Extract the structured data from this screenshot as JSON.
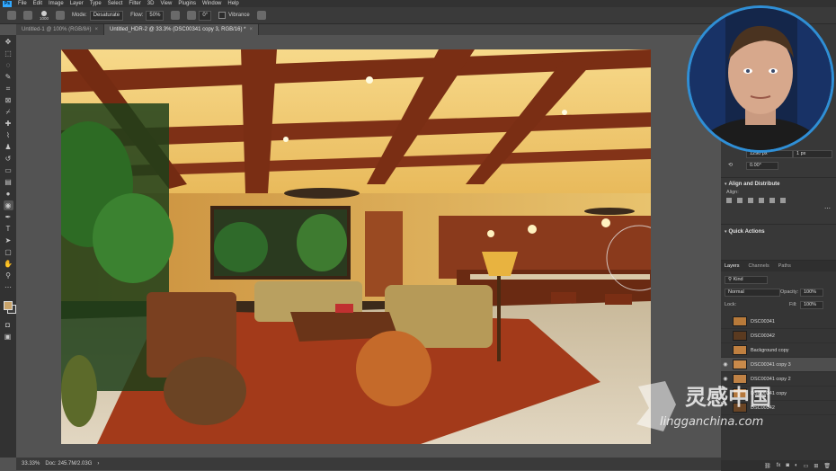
{
  "menubar": {
    "items": [
      "File",
      "Edit",
      "Image",
      "Layer",
      "Type",
      "Select",
      "Filter",
      "3D",
      "View",
      "Plugins",
      "Window",
      "Help"
    ]
  },
  "options": {
    "brush_size": "1000",
    "mode_label": "Mode:",
    "mode_value": "Desaturate",
    "flow_label": "Flow:",
    "flow_value": "50%",
    "angle_value": "0°",
    "vibrance_label": "Vibrance"
  },
  "tabs": [
    {
      "label": "Untitled-1 @ 100% (RGB/8#)"
    },
    {
      "label": "Untitled_HDR-2 @ 33.3% (DSC00341 copy 3, RGB/16) *"
    }
  ],
  "status": {
    "zoom": "33.33%",
    "doc": "Doc: 245.7M/2.03G"
  },
  "properties": {
    "w_value": "1290 px",
    "h_value": "1 px",
    "angle_value": "0.00°"
  },
  "align": {
    "title": "Align and Distribute",
    "align_label": "Align:"
  },
  "quick_actions": {
    "title": "Quick Actions"
  },
  "layers_panel": {
    "tabs": [
      "Layers",
      "Channels",
      "Paths"
    ],
    "kind_label": "Kind",
    "blend_mode": "Normal",
    "opacity_label": "Opacity:",
    "opacity_value": "100%",
    "lock_label": "Lock:",
    "fill_label": "Fill:",
    "fill_value": "100%",
    "layers": [
      {
        "name": "DSC00341",
        "visible": false,
        "thumb": "#b87a3a"
      },
      {
        "name": "DSC00342",
        "visible": false,
        "thumb": "#5a3a20"
      },
      {
        "name": "Background copy",
        "visible": false,
        "thumb": "#c08040"
      },
      {
        "name": "DSC00341 copy 3",
        "visible": true,
        "selected": true,
        "thumb": "#c98a4a"
      },
      {
        "name": "DSC00341 copy 2",
        "visible": true,
        "thumb": "#c08245"
      },
      {
        "name": "DSC00341 copy",
        "visible": false,
        "thumb": "#b5783c"
      },
      {
        "name": "DSC00342",
        "visible": false,
        "thumb": "#6a4525"
      }
    ]
  },
  "watermark": {
    "title": "灵感中国",
    "url": "lingganchina.com"
  },
  "colors": {
    "ps_blue": "#31a8ff",
    "webcam_ring": "#2f8fd6"
  }
}
